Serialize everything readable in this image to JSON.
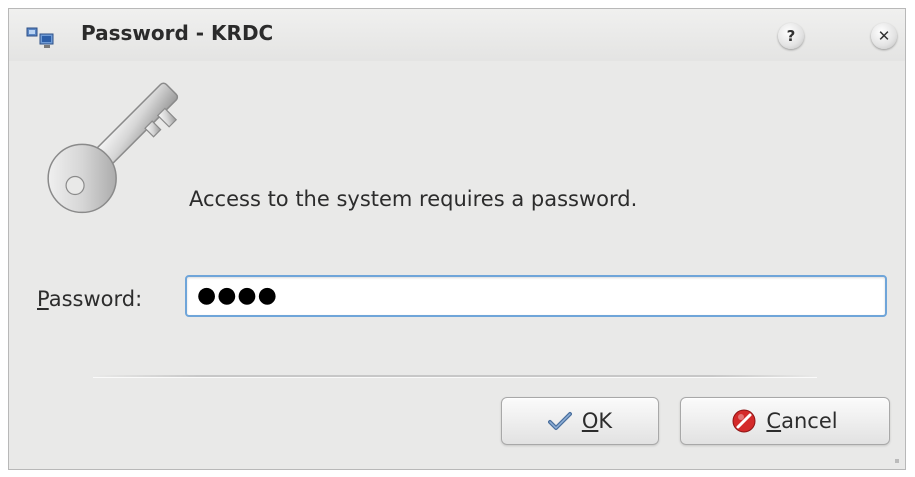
{
  "window": {
    "title": "Password - KRDC"
  },
  "titlebar": {
    "help_label": "?",
    "close_label": "✕"
  },
  "dialog": {
    "message": "Access to the system requires a password.",
    "password_label_mnemonic": "P",
    "password_label_rest": "assword:",
    "password_value": "●●●●"
  },
  "buttons": {
    "ok_mnemonic": "O",
    "ok_rest": "K",
    "cancel_mnemonic": "C",
    "cancel_rest": "ancel"
  },
  "icons": {
    "app": "krdc-app-icon",
    "key": "key-icon",
    "ok": "checkmark-icon",
    "cancel": "cancel-icon"
  },
  "colors": {
    "input_focus_border": "#6fa5d9",
    "cancel_icon": "#d42a2a",
    "ok_icon": "#4a6f9d"
  }
}
